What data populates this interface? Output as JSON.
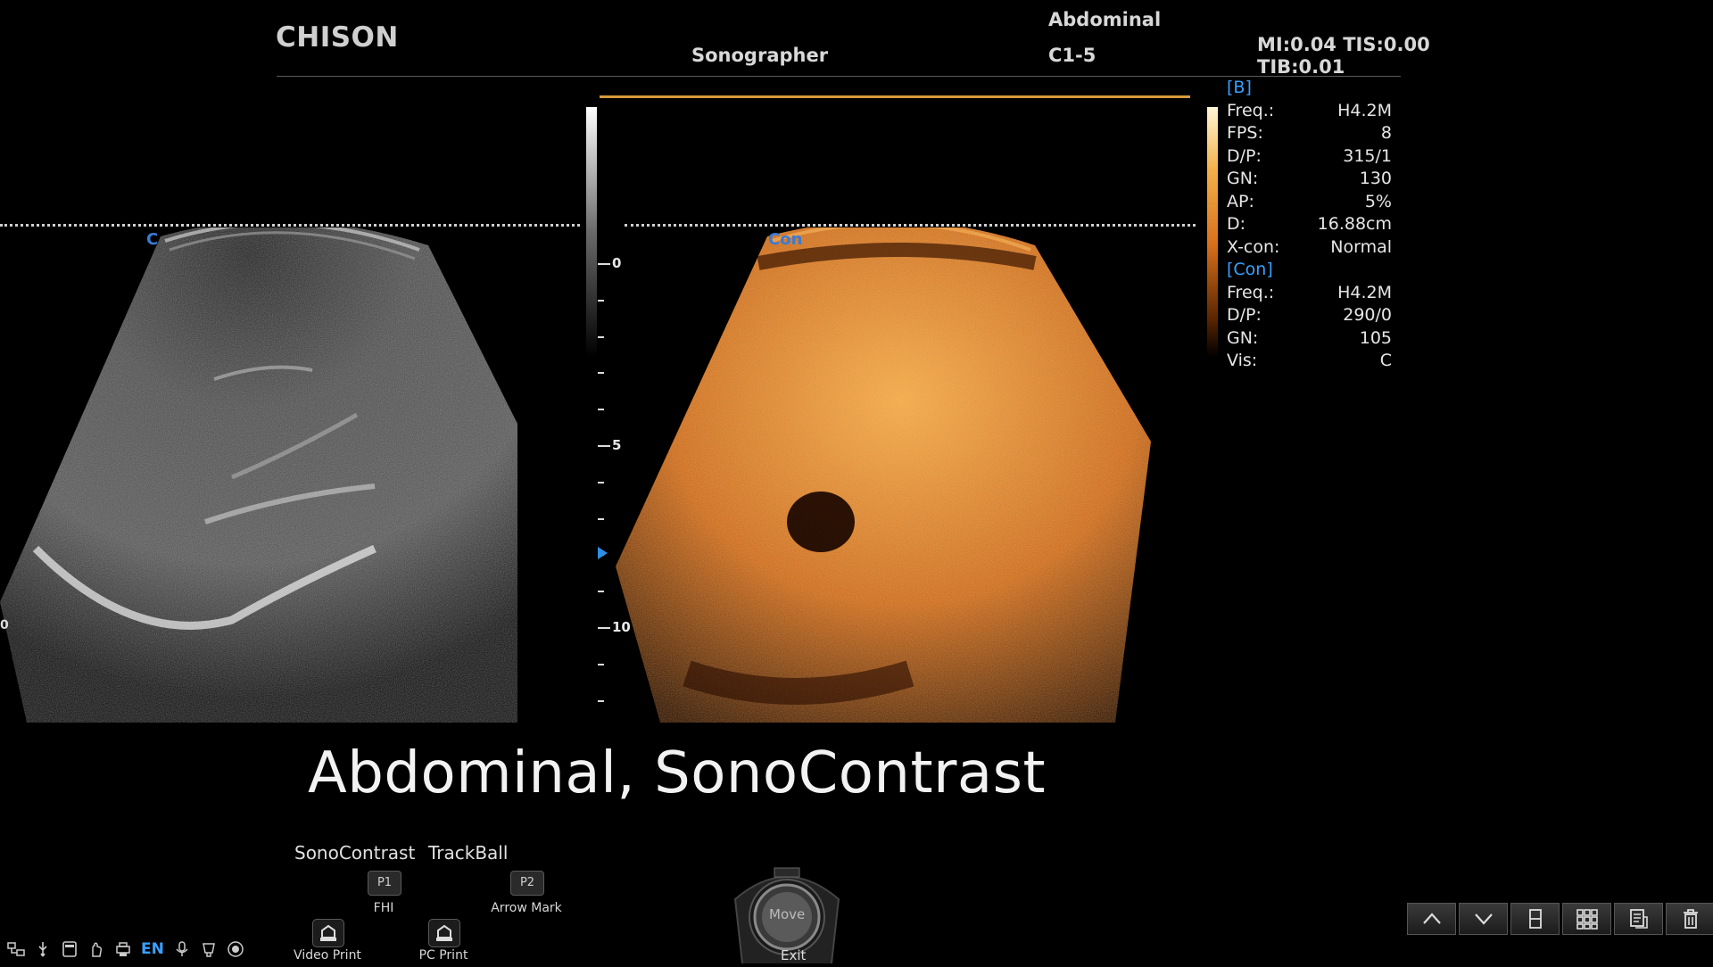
{
  "header": {
    "brand": "CHISON",
    "operator": "Sonographer",
    "exam": "Abdominal",
    "probe": "C1-5",
    "mi_tis": "MI:0.04 TIS:0.00",
    "tib": "TIB:0.01"
  },
  "params": {
    "b_section": "[B]",
    "b_rows": [
      {
        "label": "Freq.:",
        "value": "H4.2M"
      },
      {
        "label": "FPS:",
        "value": "8"
      },
      {
        "label": "D/P:",
        "value": "315/1"
      },
      {
        "label": "GN:",
        "value": "130"
      },
      {
        "label": "AP:",
        "value": "5%"
      },
      {
        "label": "D:",
        "value": "16.88cm"
      },
      {
        "label": "X-con:",
        "value": "Normal"
      }
    ],
    "con_section": "[Con]",
    "con_rows": [
      {
        "label": "Freq.:",
        "value": "H4.2M"
      },
      {
        "label": "D/P:",
        "value": "290/0"
      },
      {
        "label": "GN:",
        "value": "105"
      },
      {
        "label": "Vis:",
        "value": "C"
      }
    ]
  },
  "images": {
    "left_label": "C",
    "right_label": "Con",
    "left_edge_value": "0"
  },
  "depth_scale": {
    "labels": [
      "0",
      "5",
      "10"
    ],
    "max_cm": 12
  },
  "preset_title": "Abdominal, SonoContrast",
  "softkeys": {
    "mode": "SonoContrast",
    "trackball": "TrackBall",
    "p1": "P1",
    "p1_label": "FHI",
    "p2": "P2",
    "p2_label": "Arrow Mark",
    "video_print": "Video Print",
    "pc_print": "PC Print"
  },
  "trackball_control": {
    "center": "Move",
    "bottom": "Exit"
  },
  "status": {
    "language": "EN",
    "icons": [
      "network-icon",
      "usb-icon",
      "storage-icon",
      "hand-icon",
      "printer-icon",
      "language-indicator",
      "microphone-icon",
      "probe-icon",
      "record-icon"
    ]
  },
  "toolbar": {
    "icons": [
      "up-arrow-icon",
      "down-arrow-icon",
      "single-layout-icon",
      "quad-layout-icon",
      "report-icon",
      "trash-icon"
    ]
  },
  "colors": {
    "accent_blue": "#3aa0ff",
    "contrast_orange": "#e08a2c",
    "header_text": "#d8d8d8"
  }
}
